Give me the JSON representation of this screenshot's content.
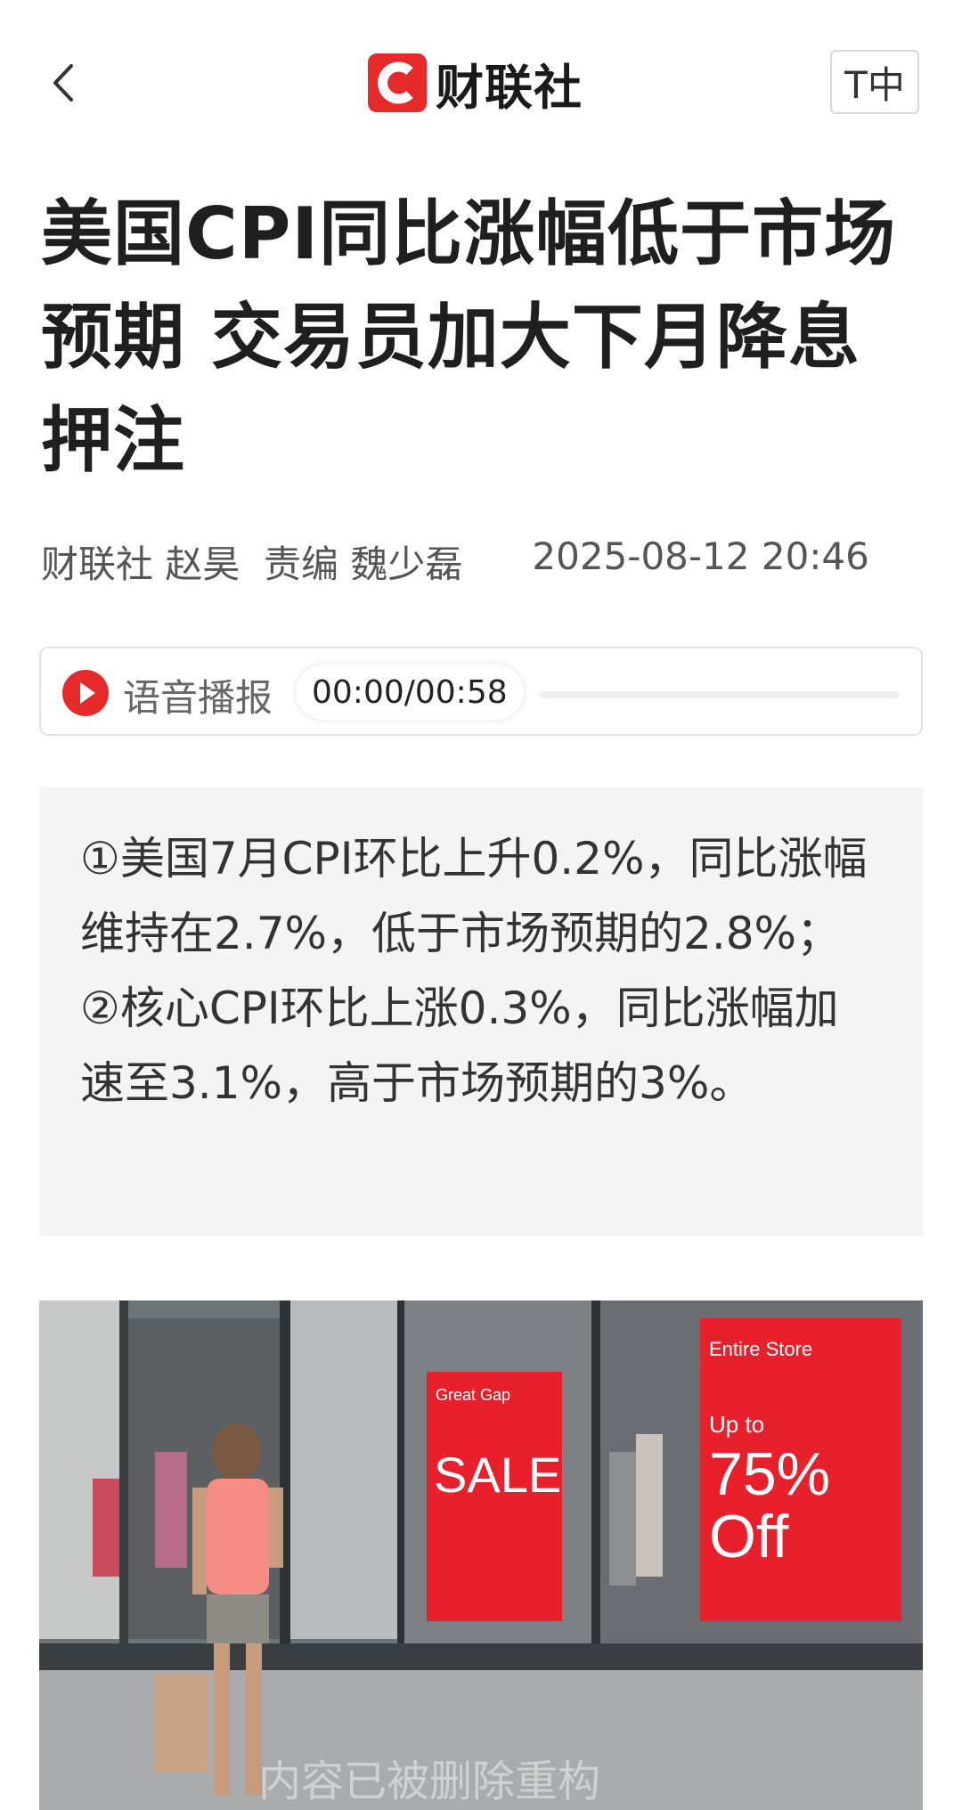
{
  "header": {
    "logo_text": "财联社",
    "font_size_button": "T中"
  },
  "article": {
    "title": "美国CPI同比涨幅低于市场预期 交易员加大下月降息押注",
    "byline": "财联社 赵昊  责编 魏少磊",
    "published_time": "2025-08-12 20:46"
  },
  "audio": {
    "label": "语音播报",
    "time": "00:00/00:58"
  },
  "summary": {
    "point1": "①美国7月CPI环比上升0.2%，同比涨幅维持在2.7%，低于市场预期的2.8%；",
    "point2": "②核心CPI环比上涨0.3%，同比涨幅加速至3.1%，高于市场预期的3%。"
  },
  "image": {
    "sign_left_small": "Great Gap",
    "sign_left_big": "SALE",
    "sign_right_small": "Entire Store",
    "sign_right_upto": "Up to",
    "sign_right_big": "75%",
    "sign_right_off": "Off",
    "watermark": "内容已被删除重构"
  },
  "colors": {
    "brand_red": "#e62a2a",
    "summary_bg": "#f4f4f4"
  }
}
